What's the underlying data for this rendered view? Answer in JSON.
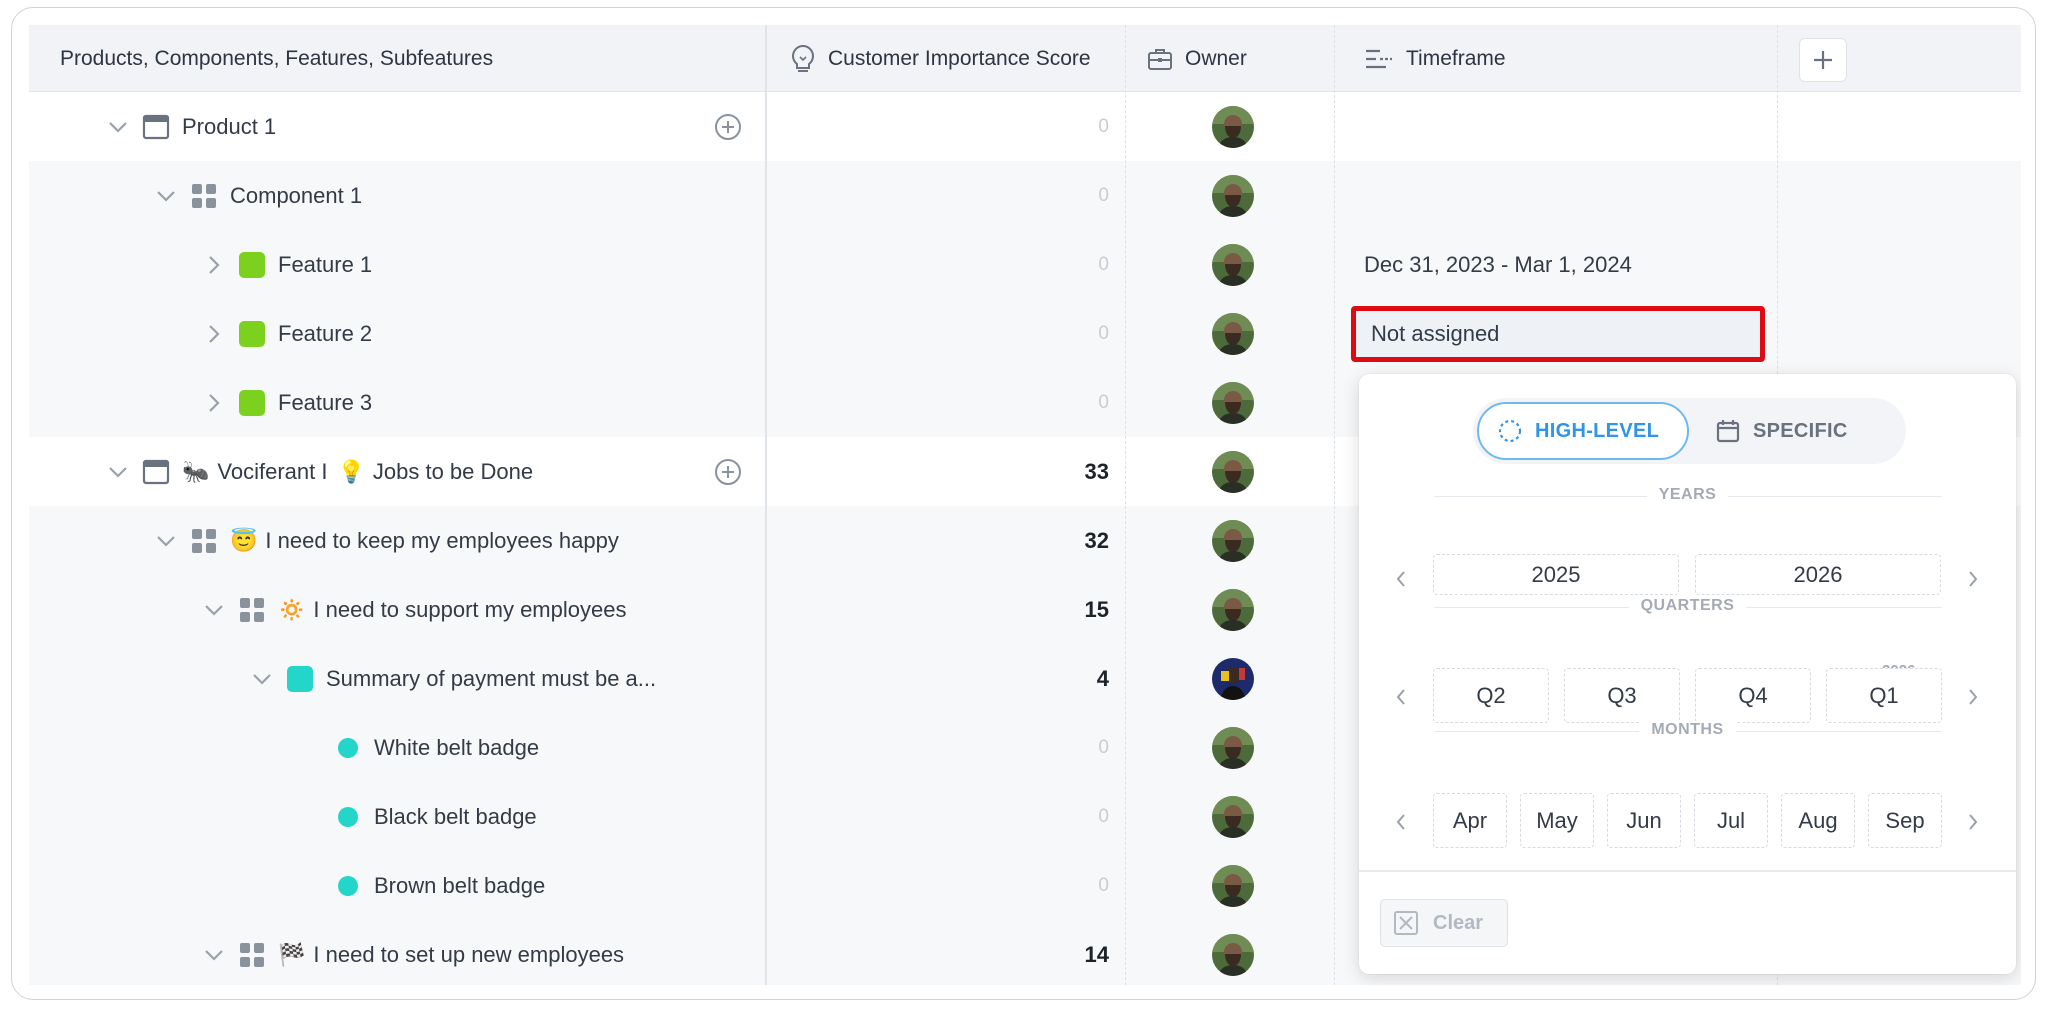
{
  "header": {
    "col_name": "Products, Components, Features, Subfeatures",
    "col_score": "Customer Importance Score",
    "col_owner": "Owner",
    "col_timeframe": "Timeframe",
    "add_column_icon": "plus-icon"
  },
  "rows": [
    {
      "name": "Product 1",
      "emoji": "",
      "score": "0",
      "timeframe": "",
      "type": "product",
      "expand": "down"
    },
    {
      "name": "Component 1",
      "emoji": "",
      "score": "0",
      "timeframe": "",
      "type": "component",
      "expand": "down"
    },
    {
      "name": "Feature 1",
      "emoji": "",
      "score": "0",
      "timeframe": "Dec 31, 2023 - Mar 1, 2024",
      "type": "feature",
      "expand": "right"
    },
    {
      "name": "Feature 2",
      "emoji": "",
      "score": "0",
      "timeframe": "Not assigned",
      "type": "feature",
      "expand": "right"
    },
    {
      "name": "Feature 3",
      "emoji": "",
      "score": "0",
      "timeframe": "",
      "type": "feature",
      "expand": "right"
    },
    {
      "name": "Vociferant I",
      "emoji": "🐜",
      "name2": "Jobs to be Done",
      "emoji2": "💡",
      "score": "33",
      "timeframe": "",
      "type": "product",
      "expand": "down"
    },
    {
      "name": "I need to keep my employees happy",
      "emoji": "😇",
      "score": "32",
      "timeframe": "",
      "type": "component",
      "expand": "down"
    },
    {
      "name": "I need to support my employees",
      "emoji": "🔅",
      "score": "15",
      "timeframe": "",
      "type": "component",
      "expand": "down"
    },
    {
      "name": "Summary of payment must be a...",
      "emoji": "",
      "score": "4",
      "timeframe": "",
      "type": "feature-teal",
      "expand": "down"
    },
    {
      "name": "White belt badge",
      "emoji": "",
      "score": "0",
      "timeframe": "",
      "type": "subfeature",
      "expand": "none"
    },
    {
      "name": "Black belt badge",
      "emoji": "",
      "score": "0",
      "timeframe": "",
      "type": "subfeature",
      "expand": "none"
    },
    {
      "name": "Brown belt badge",
      "emoji": "",
      "score": "0",
      "timeframe": "",
      "type": "subfeature",
      "expand": "none"
    },
    {
      "name": "I need to set up new employees",
      "emoji": "🏁",
      "score": "14",
      "timeframe": "",
      "type": "component",
      "expand": "down"
    }
  ],
  "popup": {
    "mode_high_level": "HIGH-LEVEL",
    "mode_specific": "SPECIFIC",
    "years_title": "YEARS",
    "years": [
      "2025",
      "2026"
    ],
    "quarters_title": "QUARTERS",
    "quarters": [
      "Q2",
      "Q3",
      "Q4",
      "Q1"
    ],
    "quarter_year_note": "2026",
    "months_title": "MONTHS",
    "months": [
      "Apr",
      "May",
      "Jun",
      "Jul",
      "Aug",
      "Sep"
    ],
    "clear_label": "Clear"
  },
  "colors": {
    "feature_green": "#7cd11f",
    "teal": "#23d6c9",
    "highlight_red": "#dd0b12",
    "accent_blue": "#2f95e8"
  }
}
